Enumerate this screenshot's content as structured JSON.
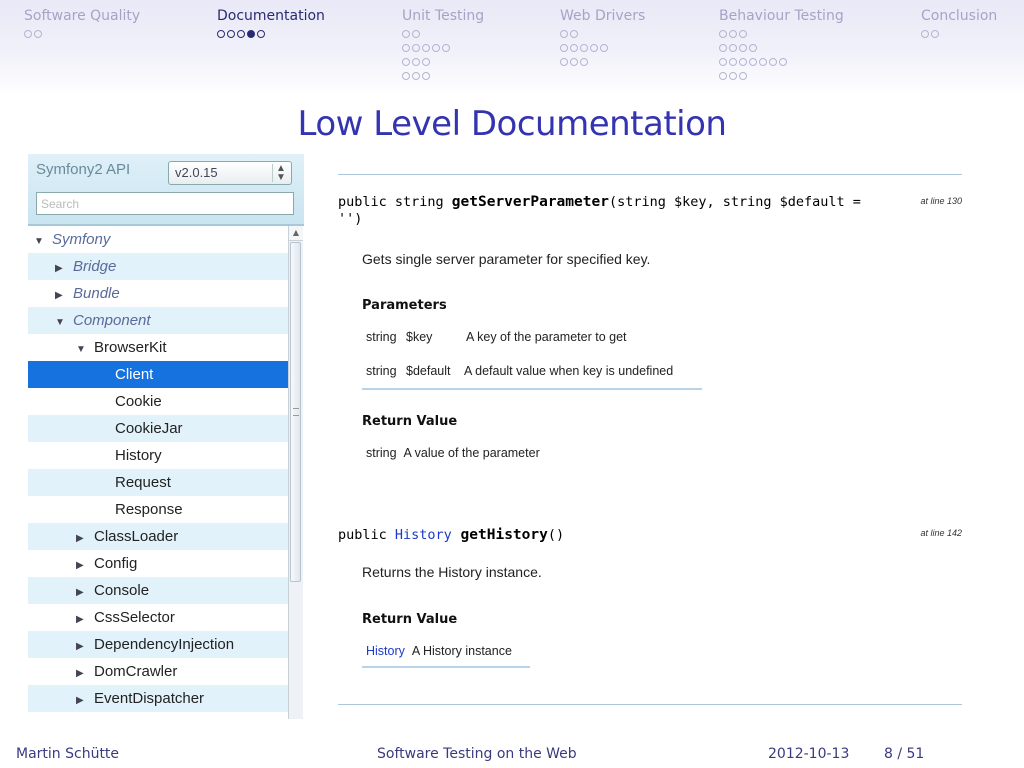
{
  "nav": {
    "sections": [
      {
        "title": "Software Quality",
        "dots": [
          2
        ],
        "active": false
      },
      {
        "title": "Documentation",
        "dots": [
          5
        ],
        "active": true,
        "current_slide": 4
      },
      {
        "title": "Unit Testing",
        "dots": [
          2,
          5,
          3,
          3
        ],
        "active": false
      },
      {
        "title": "Web Drivers",
        "dots": [
          2,
          5,
          3
        ],
        "active": false
      },
      {
        "title": "Behaviour Testing",
        "dots": [
          3,
          4,
          7,
          3
        ],
        "active": false
      },
      {
        "title": "Conclusion",
        "dots": [
          2
        ],
        "active": false
      }
    ]
  },
  "slide": {
    "title": "Low Level Documentation"
  },
  "api_panel": {
    "title": "Symfony2 API",
    "version": "v2.0.15",
    "search_placeholder": "Search",
    "tree": [
      {
        "label": "Symfony",
        "arrow": "▼",
        "italic": true
      },
      {
        "label": "Bridge",
        "arrow": "▶",
        "italic": true
      },
      {
        "label": "Bundle",
        "arrow": "▶",
        "italic": true
      },
      {
        "label": "Component",
        "arrow": "▼",
        "italic": true
      },
      {
        "label": "BrowserKit",
        "arrow": "▼",
        "italic": false
      },
      {
        "label": "Client",
        "arrow": "",
        "italic": false,
        "selected": true
      },
      {
        "label": "Cookie",
        "arrow": "",
        "italic": false
      },
      {
        "label": "CookieJar",
        "arrow": "",
        "italic": false
      },
      {
        "label": "History",
        "arrow": "",
        "italic": false
      },
      {
        "label": "Request",
        "arrow": "",
        "italic": false
      },
      {
        "label": "Response",
        "arrow": "",
        "italic": false
      },
      {
        "label": "ClassLoader",
        "arrow": "▶",
        "italic": false
      },
      {
        "label": "Config",
        "arrow": "▶",
        "italic": false
      },
      {
        "label": "Console",
        "arrow": "▶",
        "italic": false
      },
      {
        "label": "CssSelector",
        "arrow": "▶",
        "italic": false
      },
      {
        "label": "DependencyInjection",
        "arrow": "▶",
        "italic": false
      },
      {
        "label": "DomCrawler",
        "arrow": "▶",
        "italic": false
      },
      {
        "label": "EventDispatcher",
        "arrow": "▶",
        "italic": false
      }
    ]
  },
  "doc": {
    "method1": {
      "sig_prefix": "public string ",
      "name": "getServerParameter",
      "sig_args": "(string $key, string $default = ",
      "sig_args_line2": "'')",
      "at_line": "at line 130",
      "description": "Gets single server parameter for specified key.",
      "params_heading": "Parameters",
      "params": [
        {
          "type": "string",
          "name": "$key",
          "desc": "A key of the parameter to get"
        },
        {
          "type": "string",
          "name": "$default",
          "desc": "A default value when key is undefined"
        }
      ],
      "return_heading": "Return Value",
      "return_type": "string",
      "return_desc": "A value of the parameter"
    },
    "method2": {
      "sig_prefix": "public ",
      "return_type_link": "History",
      "name": " getHistory",
      "sig_args": "()",
      "at_line": "at line 142",
      "description": "Returns the History instance.",
      "return_heading": "Return Value",
      "return_type": "History",
      "return_desc": "A History instance"
    }
  },
  "footer": {
    "author": "Martin Schütte",
    "talk": "Software Testing on the Web",
    "date": "2012-10-13",
    "page": "8 / 51"
  },
  "colors": {
    "accent": "#3434b0",
    "selected_row": "#1572de",
    "alt_row": "#e2f2fa",
    "link": "#1a3acc"
  }
}
